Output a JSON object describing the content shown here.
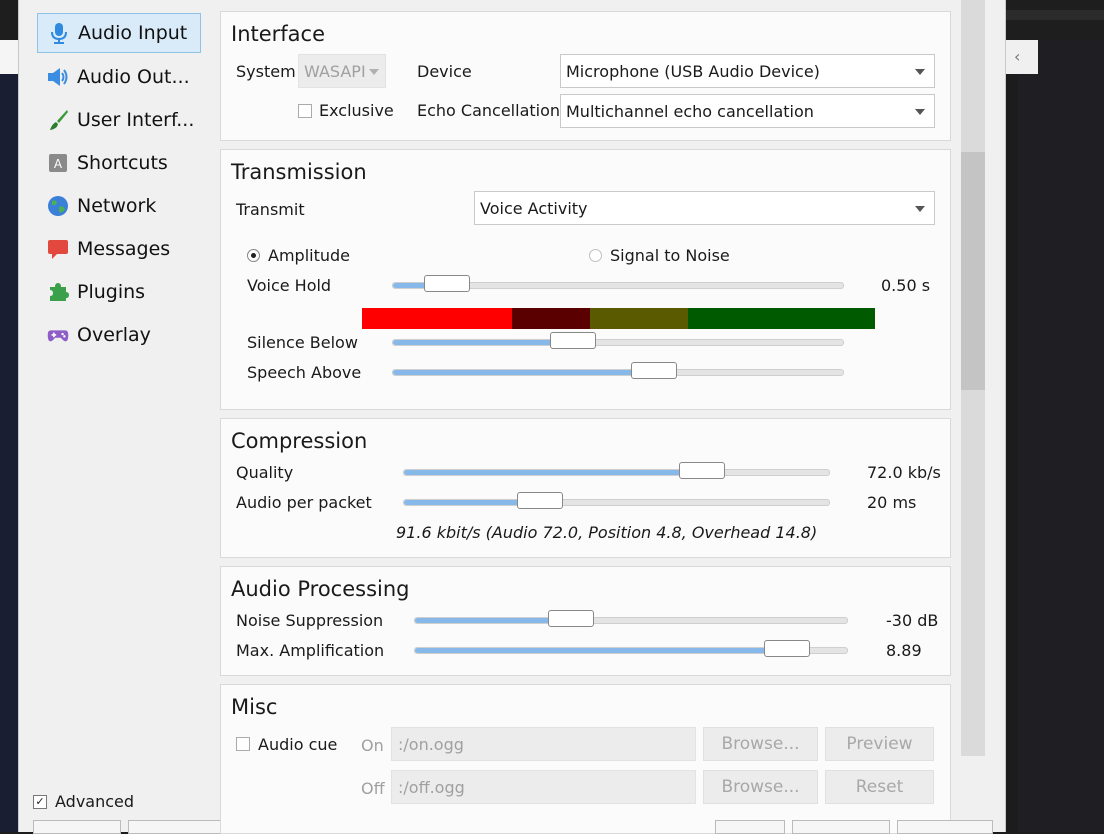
{
  "sidebar": {
    "items": [
      {
        "label": "Audio Input",
        "icon": "microphone-icon",
        "selected": true
      },
      {
        "label": "Audio Out...",
        "icon": "speaker-icon"
      },
      {
        "label": "User Interf...",
        "icon": "brush-icon"
      },
      {
        "label": "Shortcuts",
        "icon": "keyboard-key-icon"
      },
      {
        "label": "Network",
        "icon": "globe-icon"
      },
      {
        "label": "Messages",
        "icon": "speech-bubble-icon"
      },
      {
        "label": "Plugins",
        "icon": "puzzle-piece-icon"
      },
      {
        "label": "Overlay",
        "icon": "gamepad-icon"
      }
    ],
    "advanced_label": "Advanced",
    "advanced_checked": true
  },
  "interface": {
    "title": "Interface",
    "system_label": "System",
    "system_value": "WASAPI",
    "exclusive_label": "Exclusive",
    "exclusive_checked": false,
    "device_label": "Device",
    "device_value": "Microphone (USB Audio Device)",
    "echo_label": "Echo Cancellation",
    "echo_value": "Multichannel echo cancellation"
  },
  "transmission": {
    "title": "Transmission",
    "transmit_label": "Transmit",
    "transmit_value": "Voice Activity",
    "amplitude_label": "Amplitude",
    "amplitude_selected": true,
    "snr_label": "Signal to Noise",
    "snr_selected": false,
    "voice_hold_label": "Voice Hold",
    "voice_hold_value": "0.50 s",
    "voice_hold_level": 0.12,
    "silence_below_label": "Silence Below",
    "silence_below_level": 0.4,
    "speech_above_label": "Speech Above",
    "speech_above_level": 0.58,
    "meter_colors": [
      "#ff0000",
      "#5a0000",
      "#5a5a00",
      "#005a00"
    ],
    "meter_fractions": [
      0.293,
      0.151,
      0.192,
      0.364
    ]
  },
  "compression": {
    "title": "Compression",
    "quality_label": "Quality",
    "quality_value": "72.0 kb/s",
    "quality_level": 0.7,
    "packet_label": "Audio per packet",
    "packet_value": "20 ms",
    "packet_level": 0.32,
    "summary": "91.6 kbit/s (Audio 72.0, Position 4.8, Overhead 14.8)"
  },
  "processing": {
    "title": "Audio Processing",
    "noise_label": "Noise Suppression",
    "noise_value": "-30 dB",
    "noise_level": 0.36,
    "amp_label": "Max. Amplification",
    "amp_value": "8.89",
    "amp_level": 0.86
  },
  "misc": {
    "title": "Misc",
    "audio_cue_label": "Audio cue",
    "audio_cue_checked": false,
    "on_label": "On",
    "on_value": ":/on.ogg",
    "off_label": "Off",
    "off_value": ":/off.ogg",
    "browse_label": "Browse...",
    "preview_label": "Preview",
    "reset_label": "Reset"
  }
}
